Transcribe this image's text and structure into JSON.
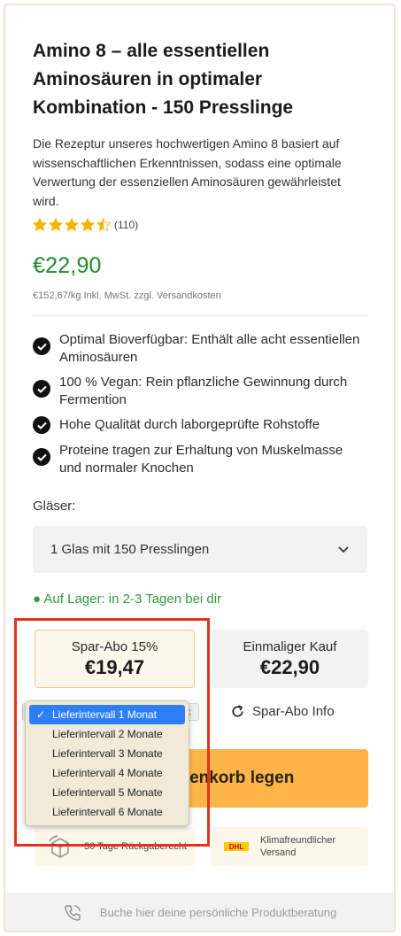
{
  "product": {
    "title": "Amino 8 – alle essentiellen Aminosäuren in optimaler Kombination - 150 Presslinge",
    "description": "Die Rezeptur unseres hochwertigen Amino 8 basiert auf wissenschaftlichen Erkenntnissen, sodass eine optimale Verwertung der essenziellen Aminosäuren gewährleistet wird.",
    "rating": 4.5,
    "rating_max": 5,
    "rating_count": "(110)",
    "price": "€22,90",
    "unit_price": "€152,67/kg Inkl. MwSt. zzgl. Versandkosten"
  },
  "features": [
    "Optimal Bioverfügbar: Enthält alle acht essentiellen Aminosäuren",
    "100 % Vegan: Rein pflanzliche Gewinnung durch Fermention",
    "Hohe Qualität durch laborgeprüfte Rohstoffe",
    "Proteine tragen zur Erhaltung von Muskelmasse und normaler Knochen"
  ],
  "variant": {
    "label": "Gläser:",
    "selected": "1 Glas mit 150 Presslingen"
  },
  "stock": "● Auf Lager: in 2-3 Tagen bei dir",
  "purchase_options": {
    "subscription": {
      "title": "Spar-Abo 15%",
      "price": "€19,47"
    },
    "one_time": {
      "title": "Einmaliger Kauf",
      "price": "€22,90"
    }
  },
  "interval_dropdown": {
    "selected_index": 0,
    "options": [
      "Lieferintervall 1 Monat",
      "Lieferintervall 2 Monate",
      "Lieferintervall 3 Monate",
      "Lieferintervall 4 Monate",
      "Lieferintervall 5 Monate",
      "Lieferintervall 6 Monate"
    ],
    "check_mark": "✓"
  },
  "abo_info_label": "Spar-Abo Info",
  "cart_button_label": "renkorb legen",
  "badges": {
    "returns": "30 Tage Rückgaberecht",
    "shipping": "Klimafreundlicher Versand",
    "shipping_logo": "DHL"
  },
  "footer_text": "Buche hier deine persönliche Produktberatung",
  "colors": {
    "price_green": "#1f8a2b",
    "stock_green": "#2e9a3f",
    "star_gold": "#f4b400",
    "cart_orange": "#fdb54a",
    "highlight_red": "#e2341d",
    "selected_blue": "#2d7ff9"
  },
  "icons": {
    "check": "check-circle-icon",
    "chevron": "chevron-down-icon",
    "refresh": "refresh-icon",
    "returns": "box-return-icon",
    "shipping": "dhl-logo-icon",
    "phone": "phone-icon"
  }
}
